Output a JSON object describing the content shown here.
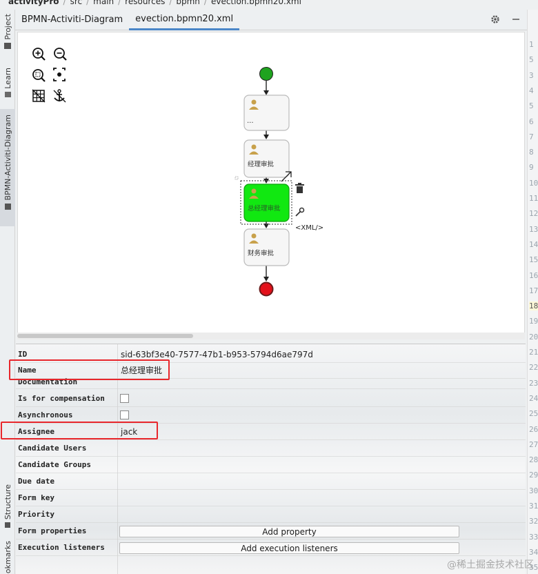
{
  "breadcrumb": {
    "project": "activityPro",
    "parts": [
      "src",
      "main",
      "resources",
      "bpmn"
    ],
    "file": "evection.bpmn20.xml"
  },
  "left_tabs": {
    "project": "Project",
    "learn": "Learn",
    "diagram": "BPMN-Activiti-Diagram",
    "structure": "Structure",
    "bookmarks": "okmarks"
  },
  "tabs": [
    {
      "label": "BPMN-Activiti-Diagram",
      "active": false
    },
    {
      "label": "evection.bpmn20.xml",
      "active": true
    }
  ],
  "diagram": {
    "tasks": [
      {
        "label": "..."
      },
      {
        "label": "经理审批"
      },
      {
        "label": "总经理审批",
        "selected": true
      },
      {
        "label": "财务审批"
      }
    ],
    "xml_hint": "<XML/>",
    "start_color": "#1fa31f",
    "end_color": "#e3111b",
    "selected_color": "#11e811"
  },
  "properties": {
    "rows": [
      {
        "key": "ID",
        "value": "sid-63bf3e40-7577-47b1-b953-5794d6ae797d"
      },
      {
        "key": "Name",
        "value": "总经理审批"
      },
      {
        "key": "Documentation",
        "value": ""
      },
      {
        "key": "Is for compensation",
        "value": ""
      },
      {
        "key": "Asynchronous",
        "value": ""
      },
      {
        "key": "Assignee",
        "value": "jack"
      },
      {
        "key": "Candidate Users",
        "value": ""
      },
      {
        "key": "Candidate Groups",
        "value": ""
      },
      {
        "key": "Due date",
        "value": ""
      },
      {
        "key": "Form key",
        "value": ""
      },
      {
        "key": "Priority",
        "value": ""
      },
      {
        "key": "Form properties",
        "value": ""
      },
      {
        "key": "Execution listeners",
        "value": ""
      }
    ],
    "add_property_label": "Add property",
    "add_execution_listeners_label": "Add execution listeners"
  },
  "gutter_lines": [
    "1",
    "5",
    "3",
    "4",
    "5",
    "6",
    "7",
    "8",
    "9",
    "10",
    "11",
    "12",
    "13",
    "14",
    "15",
    "16",
    "17",
    "18",
    "19",
    "20",
    "21",
    "22",
    "23",
    "24",
    "25",
    "26",
    "27",
    "28",
    "29",
    "30",
    "31",
    "32",
    "33",
    "34",
    "35"
  ],
  "watermark": "@稀土掘金技术社区",
  "accent_color": "#4a86c8",
  "highlight_color": "#e8262b"
}
